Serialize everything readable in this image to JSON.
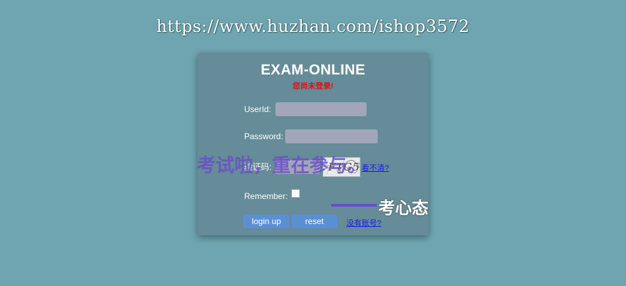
{
  "watermark": "https://www.huzhan.com/ishop3572",
  "form": {
    "title": "EXAM-ONLINE",
    "status": "您尚未登录!",
    "userid_label": "UserId:",
    "userid_value": "",
    "password_label": "Password:",
    "password_value": "",
    "captcha_label": "验证码:",
    "captcha_value": "",
    "captcha_text": "F1G5",
    "refresh_captcha_link": "看不清?",
    "remember_label": "Remember:",
    "remember_checked": false,
    "login_button": "login up",
    "reset_button": "reset",
    "register_link": "没有账号?"
  },
  "overlay": {
    "motto_line1": "考试啦，重在参与。",
    "motto_line2": "考心态"
  },
  "colors": {
    "background": "#6ea5b0",
    "card": "#658c98",
    "input": "#a3a6bb",
    "button": "#5b8fd3",
    "status_text": "#e01010",
    "link": "#1a1aee",
    "overlay_text": "#6a4fc7"
  }
}
